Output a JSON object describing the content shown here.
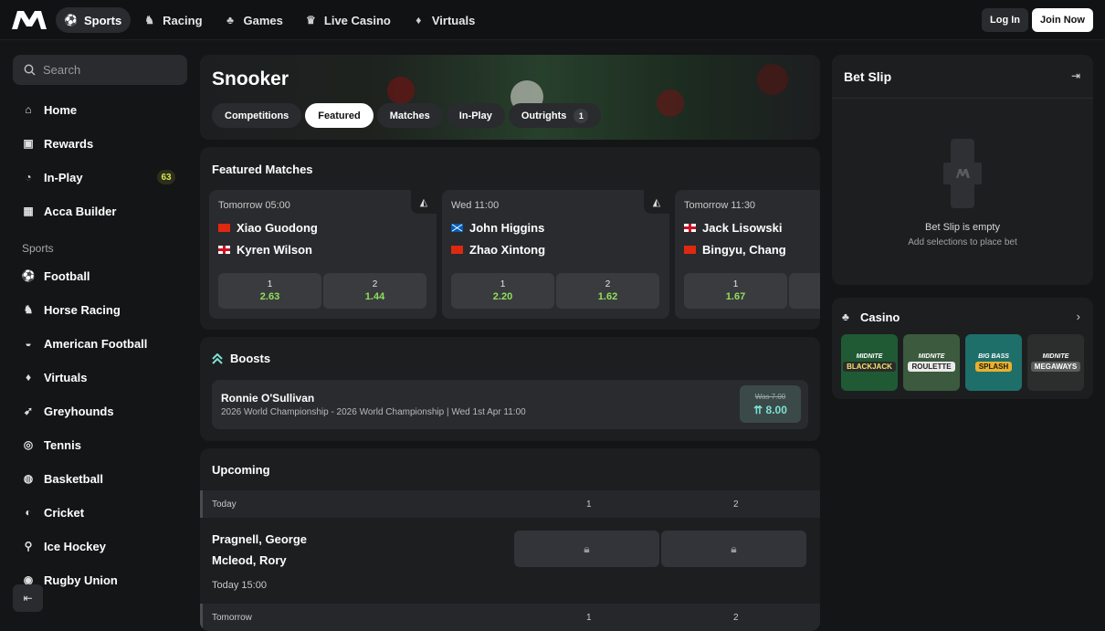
{
  "header": {
    "nav": [
      {
        "label": "Sports",
        "icon": "football-icon",
        "glyph": "⚽",
        "active": true
      },
      {
        "label": "Racing",
        "icon": "horse-icon",
        "glyph": "♞"
      },
      {
        "label": "Games",
        "icon": "cards-icon",
        "glyph": "♣"
      },
      {
        "label": "Live Casino",
        "icon": "trophy-icon",
        "glyph": "♛"
      },
      {
        "label": "Virtuals",
        "icon": "virtual-icon",
        "glyph": "♦"
      }
    ],
    "login_label": "Log In",
    "join_label": "Join Now"
  },
  "sidebar": {
    "search_placeholder": "Search",
    "main_items": [
      {
        "label": "Home",
        "glyph": "⌂"
      },
      {
        "label": "Rewards",
        "glyph": "▣"
      },
      {
        "label": "In-Play",
        "glyph": "◔",
        "badge": "63"
      },
      {
        "label": "Acca Builder",
        "glyph": "▦"
      }
    ],
    "sports_heading": "Sports",
    "sports": [
      {
        "label": "Football",
        "glyph": "⚽"
      },
      {
        "label": "Horse Racing",
        "glyph": "♞"
      },
      {
        "label": "American Football",
        "glyph": "◒"
      },
      {
        "label": "Virtuals",
        "glyph": "♦"
      },
      {
        "label": "Greyhounds",
        "glyph": "➹"
      },
      {
        "label": "Tennis",
        "glyph": "◎"
      },
      {
        "label": "Basketball",
        "glyph": "◍"
      },
      {
        "label": "Cricket",
        "glyph": "◐"
      },
      {
        "label": "Ice Hockey",
        "glyph": "⚲"
      },
      {
        "label": "Rugby Union",
        "glyph": "◉"
      }
    ]
  },
  "hero": {
    "title": "Snooker",
    "tabs": [
      {
        "label": "Competitions"
      },
      {
        "label": "Featured",
        "active": true
      },
      {
        "label": "Matches"
      },
      {
        "label": "In-Play"
      },
      {
        "label": "Outrights",
        "count": "1"
      }
    ]
  },
  "featured": {
    "title": "Featured Matches",
    "matches": [
      {
        "time": "Tomorrow 05:00",
        "home": "Xiao Guodong",
        "home_flag": "cn",
        "away": "Kyren Wilson",
        "away_flag": "en",
        "odds": [
          {
            "label": "1",
            "value": "2.63"
          },
          {
            "label": "2",
            "value": "1.44"
          }
        ]
      },
      {
        "time": "Wed 11:00",
        "home": "John Higgins",
        "home_flag": "sc",
        "away": "Zhao Xintong",
        "away_flag": "cn",
        "odds": [
          {
            "label": "1",
            "value": "2.20"
          },
          {
            "label": "2",
            "value": "1.62"
          }
        ]
      },
      {
        "time": "Tomorrow 11:30",
        "home": "Jack Lisowski",
        "home_flag": "en",
        "away": "Bingyu, Chang",
        "away_flag": "cn",
        "odds": [
          {
            "label": "1",
            "value": "1.67"
          }
        ]
      }
    ]
  },
  "boosts": {
    "title": "Boosts",
    "item": {
      "name": "Ronnie O'Sullivan",
      "description": "2026 World Championship - 2026 World Championship | Wed 1st Apr 11:00",
      "was": "Was 7.00",
      "now": "8.00"
    }
  },
  "upcoming": {
    "title": "Upcoming",
    "groups": [
      {
        "day": "Today",
        "col1": "1",
        "col2": "2"
      },
      {
        "day": "Tomorrow",
        "col1": "1",
        "col2": "2"
      }
    ],
    "match": {
      "home": "Pragnell, George",
      "away": "Mcleod, Rory",
      "time": "Today 15:00"
    }
  },
  "betslip": {
    "title": "Bet Slip",
    "empty_title": "Bet Slip is empty",
    "empty_sub": "Add selections to place bet"
  },
  "casino": {
    "title": "Casino",
    "games": [
      {
        "brand": "MIDNITE",
        "name": "BLACKJACK",
        "bg": "#1f5a34",
        "tag": "#2b2b2b",
        "tagcolor": "#f3e36a"
      },
      {
        "brand": "MIDNITE",
        "name": "ROULETTE",
        "bg": "#3c5a3e",
        "tag": "#eaeaea",
        "tagcolor": "#222"
      },
      {
        "brand": "BIG BASS",
        "name": "SPLASH",
        "bg": "#1e6f6a",
        "tag": "#e9b12b",
        "tagcolor": "#1a1a1a"
      },
      {
        "brand": "MIDNITE",
        "name": "MEGAWAYS",
        "bg": "#2b2e2c",
        "tag": "#5a5d5b",
        "tagcolor": "#fff"
      }
    ]
  },
  "colors": {
    "odds_green": "#8ee05b",
    "boost_teal": "#7fe0d4",
    "badge_yellow": "#d7e44d"
  }
}
